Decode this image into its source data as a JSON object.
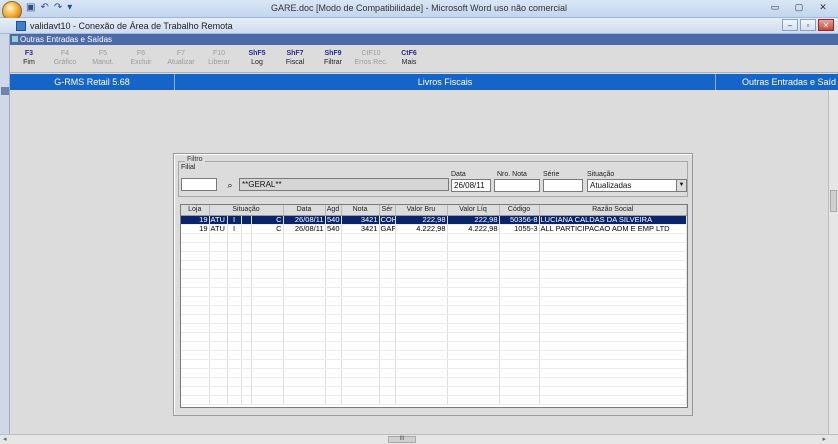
{
  "word": {
    "title": "GARE.doc [Modo de Compatibilidade] - Microsoft Word uso não comercial",
    "qat": [
      "▣",
      "↶",
      "↷",
      "▾"
    ],
    "controls": [
      "▭",
      "▢",
      "✕"
    ]
  },
  "rdp": {
    "title": "validavt10 - Conexão de Área de Trabalho Remota",
    "controls": [
      "–",
      "▫",
      "✕"
    ]
  },
  "app": {
    "window_title": "Outras Entradas e Saídas",
    "fkeys": [
      {
        "key": "F3",
        "label": "Fim",
        "enabled": true
      },
      {
        "key": "F4",
        "label": "Gráfico",
        "enabled": false
      },
      {
        "key": "F5",
        "label": "Manut.",
        "enabled": false
      },
      {
        "key": "F6",
        "label": "Excluir",
        "enabled": false
      },
      {
        "key": "F7",
        "label": "Atualizar",
        "enabled": false
      },
      {
        "key": "F10",
        "label": "Liberar",
        "enabled": false
      },
      {
        "key": "ShF5",
        "label": "Log",
        "enabled": true
      },
      {
        "key": "ShF7",
        "label": "Fiscal",
        "enabled": true
      },
      {
        "key": "ShF9",
        "label": "Filtrar",
        "enabled": true
      },
      {
        "key": "CtF10",
        "label": "Erros Rec.",
        "enabled": false
      },
      {
        "key": "CtF6",
        "label": "Mais",
        "enabled": true
      }
    ],
    "bar_left": "G-RMS Retail 5.68",
    "bar_center": "Livros Fiscais",
    "bar_right": "Outras Entradas e Saíd"
  },
  "filter": {
    "legend": "Filtro",
    "filial_label": "Filial",
    "filial_value": "",
    "filial_name": "**GERAL**",
    "data_label": "Data",
    "data_value": "26/08/11",
    "nro_nota_label": "Nro. Nota",
    "nro_nota_value": "",
    "serie_label": "Série",
    "serie_value": "",
    "situacao_label": "Situação",
    "situacao_value": "Atualizadas"
  },
  "grid": {
    "columns": [
      "Loja",
      "",
      "Situação",
      "",
      "",
      "Data",
      "Agd",
      "Nota",
      "Sér",
      "Valor Bru",
      "Valor Líq",
      "Código",
      "Razão Social"
    ],
    "rows": [
      {
        "loja": "19",
        "sit": "ATU",
        "a": "I",
        "b": "",
        "c": "C",
        "data": "26/08/11",
        "agd": "540",
        "nota": "3421",
        "ser": "COH",
        "bru": "222,98",
        "liq": "222,98",
        "cod": "50356-8",
        "razao": "LUCIANA CALDAS DA SILVEIRA",
        "selected": true
      },
      {
        "loja": "19",
        "sit": "ATU",
        "a": "I",
        "b": "",
        "c": "C",
        "data": "26/08/11",
        "agd": "540",
        "nota": "3421",
        "ser": "GAF",
        "bru": "4.222,98",
        "liq": "4.222,98",
        "cod": "1055-3",
        "razao": "ALL PARTICIPACAO ADM E EMP LTD",
        "selected": false
      }
    ]
  },
  "hscroll_thumb": "III"
}
